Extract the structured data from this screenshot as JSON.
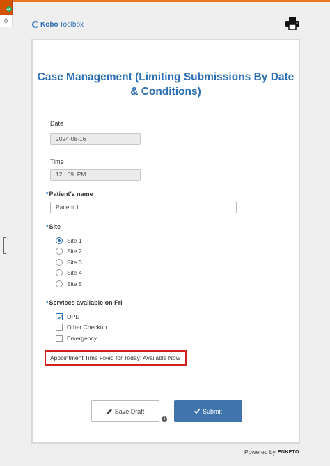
{
  "corner": {
    "count": "0"
  },
  "header": {
    "logo_primary": "Kobo",
    "logo_secondary": "Toolbox",
    "print_icon": "printer-icon"
  },
  "form": {
    "title": "Case Management (Limiting Submissions By Date & Conditions)",
    "date": {
      "label": "Date",
      "value": "2024-08-16"
    },
    "time": {
      "label": "Time",
      "value": "12 : 09  PM"
    },
    "patient": {
      "required_mark": "*",
      "label": "Patient's name",
      "value": "Patient 1"
    },
    "site": {
      "required_mark": "*",
      "label": "Site",
      "selected": "Site 1",
      "options": [
        "Site 1",
        "Site 2",
        "Site 3",
        "Site 4",
        "Site 5"
      ]
    },
    "services": {
      "required_mark": "*",
      "label": "Services available on Fri",
      "options": [
        {
          "label": "OPD",
          "checked": true
        },
        {
          "label": "Other Checkup",
          "checked": false
        },
        {
          "label": "Emergency",
          "checked": false
        }
      ]
    },
    "note": "Appointment Time Fixed for Today: Available Now"
  },
  "actions": {
    "save_draft": "Save Draft",
    "submit": "Submit",
    "draft_icon": "pencil-icon",
    "submit_icon": "checkmark-icon",
    "info_icon": "info-icon"
  },
  "footer": {
    "powered_by": "Powered by",
    "brand": "ENKETO"
  },
  "colors": {
    "accent": "#2c6fb3",
    "submit_bg": "#3f74ad",
    "highlight_border": "#d0201f",
    "top_bar": "#e87722"
  }
}
